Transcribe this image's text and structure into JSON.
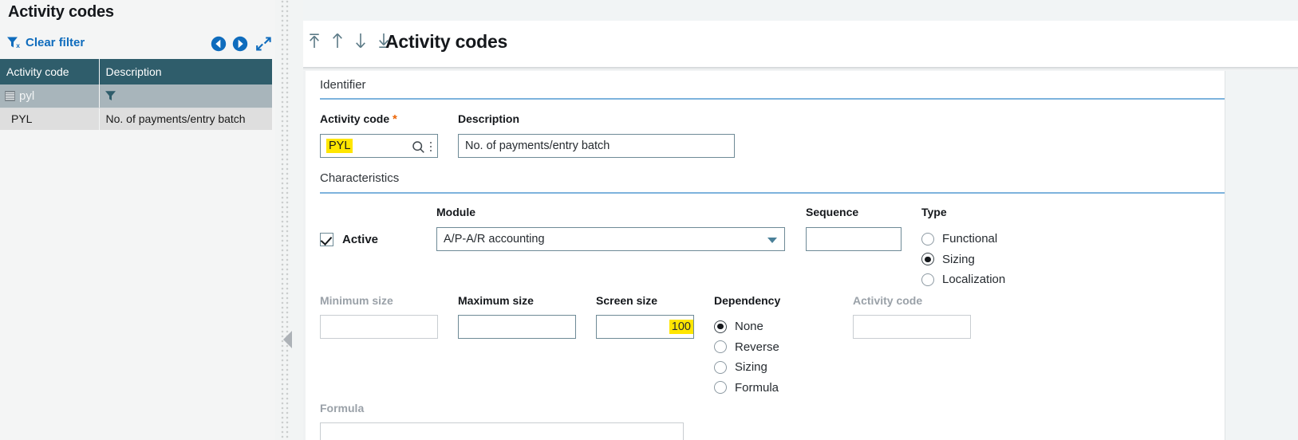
{
  "list_panel": {
    "title": "Activity codes",
    "clear_filter_label": "Clear filter",
    "icons": {
      "filter_clear": "funnel-x-icon",
      "prev": "previous-record-icon",
      "next": "next-record-icon",
      "expand": "expand-diagonal-icon"
    },
    "columns": [
      "Activity code",
      "Description"
    ],
    "filter_row": {
      "activity_code": "pyl",
      "description": ""
    },
    "rows": [
      {
        "activity_code": "PYL",
        "description": "No. of payments/entry batch"
      }
    ]
  },
  "detail_panel": {
    "title": "Activity codes",
    "record_nav": [
      {
        "name": "first-record",
        "glyph": "first"
      },
      {
        "name": "previous-record",
        "glyph": "up"
      },
      {
        "name": "next-record",
        "glyph": "down"
      },
      {
        "name": "last-record",
        "glyph": "last"
      }
    ],
    "sections": {
      "identifier": {
        "heading": "Identifier",
        "activity_code": {
          "label": "Activity code",
          "required_marker": "*",
          "value": "PYL",
          "highlighted": true
        },
        "description": {
          "label": "Description",
          "value": "No. of payments/entry batch"
        }
      },
      "characteristics": {
        "heading": "Characteristics",
        "active": {
          "label": "Active",
          "checked": true
        },
        "module": {
          "label": "Module",
          "value": "A/P-A/R accounting"
        },
        "sequence": {
          "label": "Sequence",
          "value": ""
        },
        "type": {
          "label": "Type",
          "options": [
            "Functional",
            "Sizing",
            "Localization"
          ],
          "selected": "Sizing"
        },
        "minimum_size": {
          "label": "Minimum size",
          "value": "",
          "disabled": true
        },
        "maximum_size": {
          "label": "Maximum size",
          "value": "",
          "disabled": false
        },
        "screen_size": {
          "label": "Screen size",
          "value": "100",
          "highlighted": true
        },
        "dependency": {
          "label": "Dependency",
          "options": [
            "None",
            "Reverse",
            "Sizing",
            "Formula"
          ],
          "selected": "None"
        },
        "dependency_activity_code": {
          "label": "Activity code",
          "value": "",
          "disabled": true
        },
        "formula": {
          "label": "Formula",
          "value": "",
          "disabled": true
        }
      }
    }
  },
  "colors": {
    "table_header_bg": "#2f5d6b",
    "filter_row_bg": "#a8b5bb",
    "data_row_bg": "#dedede",
    "link_blue": "#0f6cbd",
    "section_rule": "#7db3dd",
    "highlight_yellow": "#ffe600",
    "required_orange": "#ec6608"
  }
}
